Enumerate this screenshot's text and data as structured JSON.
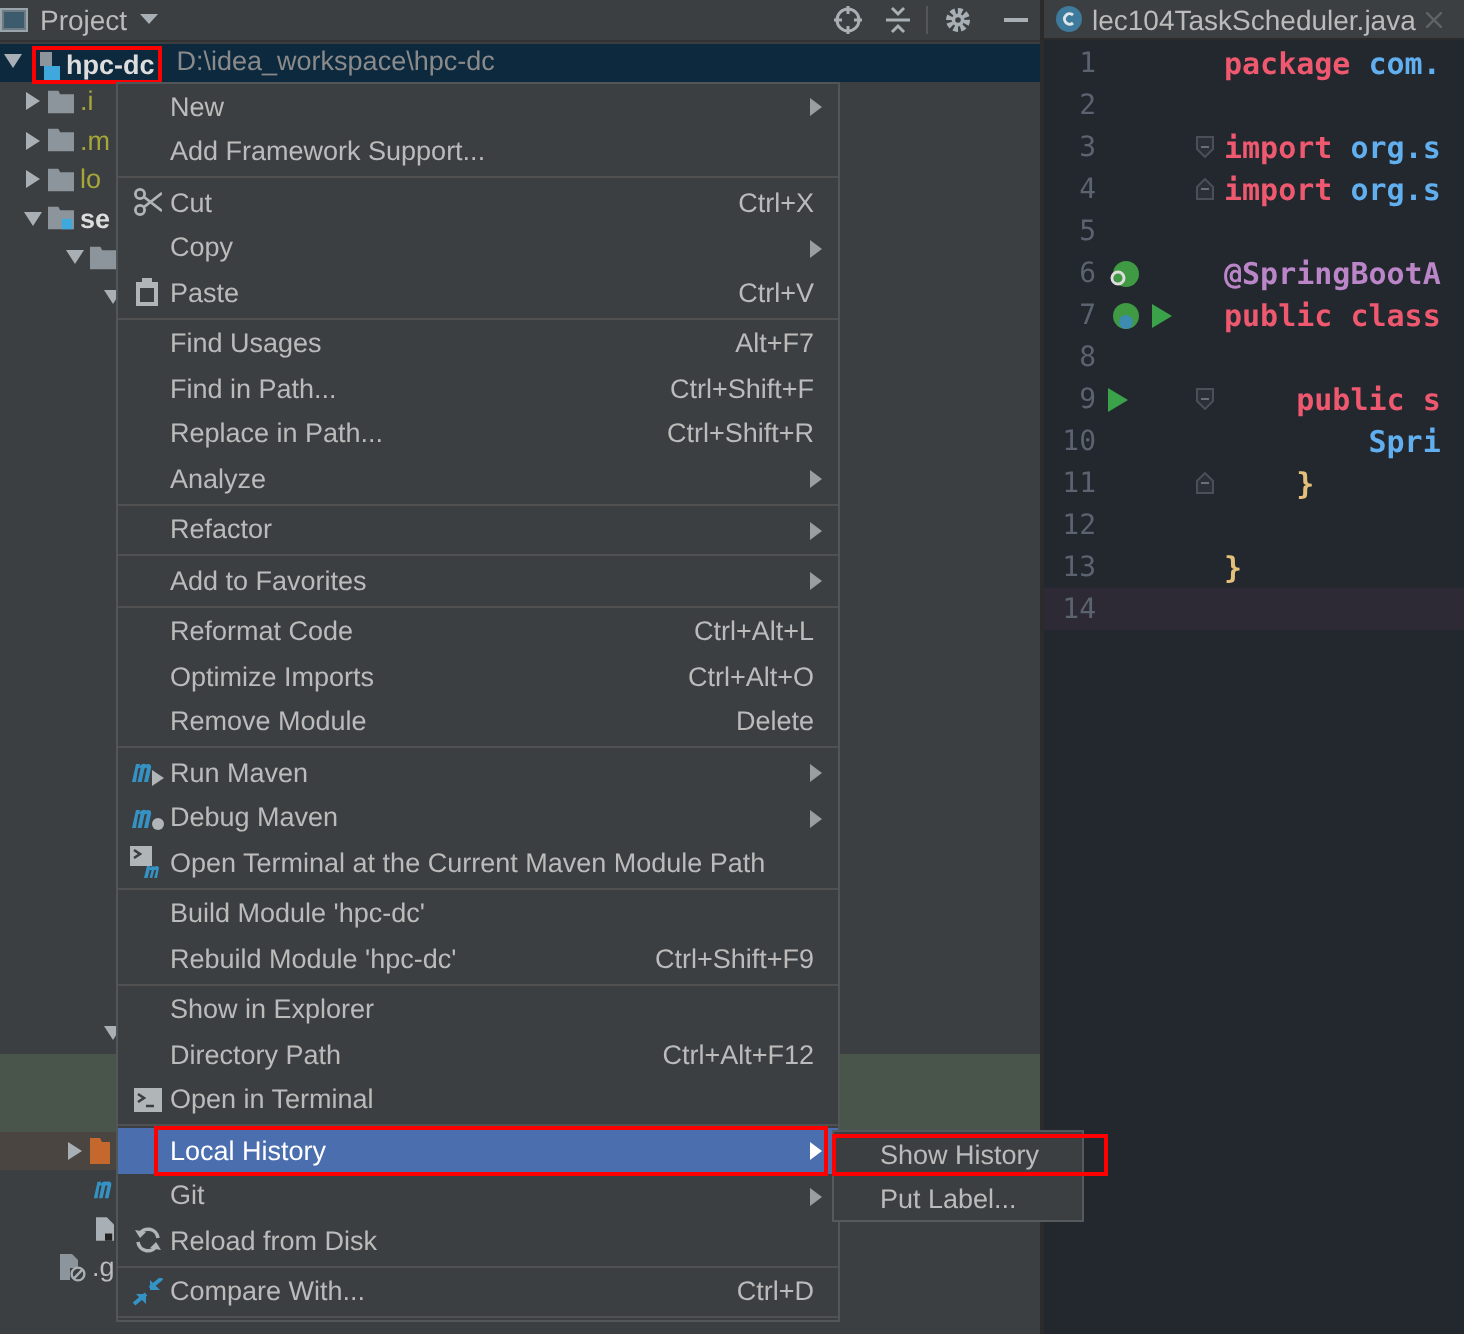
{
  "project_panel": {
    "title": "Project"
  },
  "tree": [
    {
      "name": "hpc-dc",
      "path": "D:\\idea_workspace\\hpc-dc",
      "kind": "module",
      "expanded": true,
      "selected": true,
      "outlined": true,
      "children": [
        {
          "name": ".i",
          "kind": "excluded",
          "expanded": false,
          "selected": false
        },
        {
          "name": ".m",
          "kind": "excluded",
          "expanded": false,
          "selected": false
        },
        {
          "name": "lo",
          "kind": "excluded",
          "expanded": false,
          "selected": false
        },
        {
          "name": "se",
          "kind": "source",
          "expanded": true,
          "selected": false,
          "children": [
            {
              "kind": "folder",
              "expanded": true,
              "selected": false,
              "children": [
                {
                  "expanded": true,
                  "selected": false
                }
              ]
            }
          ]
        }
      ]
    }
  ],
  "tree_tail": [
    {
      "kind": "branch"
    },
    {
      "kind": "band"
    },
    {
      "kind": "band"
    },
    {
      "kind": "resources"
    },
    {
      "kind": "maven"
    },
    {
      "kind": "file"
    },
    {
      "kind": "ignored",
      "name": ".g"
    }
  ],
  "editor": {
    "tab": {
      "title": "lec104TaskScheduler.java"
    },
    "lines": [
      {
        "number": "1",
        "tokens": [
          {
            "text": "package",
            "kind": "keyword"
          },
          {
            "text": " com.",
            "kind": "name"
          }
        ]
      },
      {
        "number": "2"
      },
      {
        "number": "3",
        "fold_start": true,
        "tokens": [
          {
            "text": "import",
            "kind": "keyword"
          },
          {
            "text": " org.s",
            "kind": "name"
          }
        ]
      },
      {
        "number": "4",
        "fold_end": true,
        "tokens": [
          {
            "text": "import",
            "kind": "keyword"
          },
          {
            "text": " org.s",
            "kind": "name"
          }
        ]
      },
      {
        "number": "5"
      },
      {
        "number": "6",
        "bean": true,
        "tokens": [
          {
            "text": "@SpringBootA",
            "kind": "annotation"
          }
        ]
      },
      {
        "number": "7",
        "bean": true,
        "run": true,
        "tokens": [
          {
            "text": "public",
            "kind": "keyword"
          },
          {
            "text": " class",
            "kind": "keyword"
          }
        ]
      },
      {
        "number": "8"
      },
      {
        "number": "9",
        "run": true,
        "fold_start": true,
        "tokens": [
          {
            "text": "    public",
            "kind": "keyword"
          },
          {
            "text": " s",
            "kind": "keyword"
          }
        ]
      },
      {
        "number": "10",
        "tokens": [
          {
            "text": "        Spri",
            "kind": "name"
          }
        ]
      },
      {
        "number": "11",
        "fold_end": true,
        "tokens": [
          {
            "text": "    }",
            "kind": "brace"
          }
        ]
      },
      {
        "number": "12"
      },
      {
        "number": "13",
        "tokens": [
          {
            "text": "}",
            "kind": "brace"
          }
        ]
      },
      {
        "number": "14",
        "current": true
      }
    ]
  },
  "context_menu": [
    {
      "kind": "item",
      "label": "New",
      "submenu": true
    },
    {
      "kind": "item",
      "label": "Add Framework Support..."
    },
    {
      "kind": "separator"
    },
    {
      "kind": "cut",
      "label": "Cut",
      "shortcut": "Ctrl+X"
    },
    {
      "kind": "item",
      "label": "Copy",
      "submenu": true
    },
    {
      "kind": "paste",
      "label": "Paste",
      "shortcut": "Ctrl+V"
    },
    {
      "kind": "separator"
    },
    {
      "kind": "item",
      "label": "Find Usages",
      "shortcut": "Alt+F7"
    },
    {
      "kind": "item",
      "label": "Find in Path...",
      "shortcut": "Ctrl+Shift+F"
    },
    {
      "kind": "item",
      "label": "Replace in Path...",
      "shortcut": "Ctrl+Shift+R"
    },
    {
      "kind": "item",
      "label": "Analyze",
      "submenu": true
    },
    {
      "kind": "separator"
    },
    {
      "kind": "item",
      "label": "Refactor",
      "submenu": true
    },
    {
      "kind": "separator"
    },
    {
      "kind": "item",
      "label": "Add to Favorites",
      "submenu": true
    },
    {
      "kind": "separator"
    },
    {
      "kind": "item",
      "label": "Reformat Code",
      "shortcut": "Ctrl+Alt+L"
    },
    {
      "kind": "item",
      "label": "Optimize Imports",
      "shortcut": "Ctrl+Alt+O"
    },
    {
      "kind": "item",
      "label": "Remove Module",
      "shortcut": "Delete"
    },
    {
      "kind": "separator"
    },
    {
      "kind": "maven",
      "label": "Run Maven",
      "submenu": true
    },
    {
      "kind": "debug",
      "label": "Debug Maven",
      "submenu": true
    },
    {
      "kind": "mvnterminal",
      "label": "Open Terminal at the Current Maven Module Path"
    },
    {
      "kind": "separator"
    },
    {
      "kind": "item",
      "label": "Build Module 'hpc-dc'"
    },
    {
      "kind": "item",
      "label": "Rebuild Module 'hpc-dc'",
      "shortcut": "Ctrl+Shift+F9"
    },
    {
      "kind": "separator"
    },
    {
      "kind": "item",
      "label": "Show in Explorer"
    },
    {
      "kind": "item",
      "label": "Directory Path",
      "shortcut": "Ctrl+Alt+F12"
    },
    {
      "kind": "terminal",
      "label": "Open in Terminal"
    },
    {
      "kind": "separator"
    },
    {
      "kind": "item",
      "label": "Local History",
      "submenu": true,
      "selected": true,
      "outlined": true
    },
    {
      "kind": "item",
      "label": "Git",
      "submenu": true
    },
    {
      "kind": "reload",
      "label": "Reload from Disk"
    },
    {
      "kind": "separator"
    },
    {
      "kind": "compare",
      "label": "Compare With...",
      "shortcut": "Ctrl+D"
    },
    {
      "kind": "separator"
    }
  ],
  "submenu": [
    {
      "label": "Show History",
      "outlined": true
    },
    {
      "label": "Put Label...",
      "outlined": false
    }
  ]
}
